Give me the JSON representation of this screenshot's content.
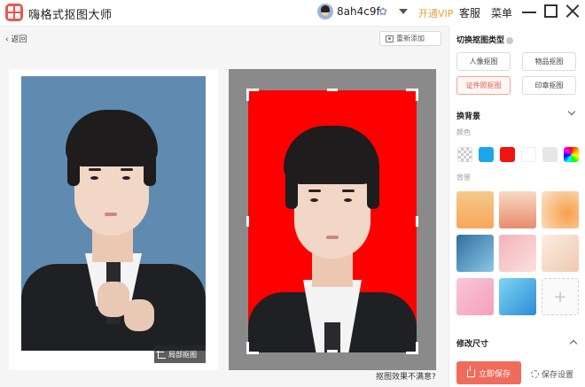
{
  "titlebar": {
    "app_title": "嗨格式抠图大师",
    "username": "8ah4c9f",
    "vip_label": "开通VIP",
    "service_label": "客服",
    "menu_label": "菜单"
  },
  "toolbar": {
    "back_label": "返回",
    "re_add_label": "重新添加"
  },
  "preview": {
    "crop_local_label": "局部抠图",
    "unsatisfied_label": "抠图效果不满意?",
    "result_background_color": "#ff0000",
    "original_background_color": "#5f8bb0"
  },
  "panel": {
    "mode_title": "切换抠图类型",
    "modes": [
      {
        "label": "人像抠图",
        "active": false
      },
      {
        "label": "物品抠图",
        "active": false
      },
      {
        "label": "证件照抠图",
        "active": true
      },
      {
        "label": "印章抠图",
        "active": false
      }
    ],
    "bg_section_title": "换背景",
    "color_label": "颜色",
    "colors": [
      "transparent",
      "#1aa7ec",
      "#f0140f",
      "#ffffff",
      "#e6e6e6",
      "rainbow"
    ],
    "bg_label": "背景",
    "resize_title": "修改尺寸",
    "save_now_label": "立即保存",
    "save_settings_label": "保存设置"
  }
}
